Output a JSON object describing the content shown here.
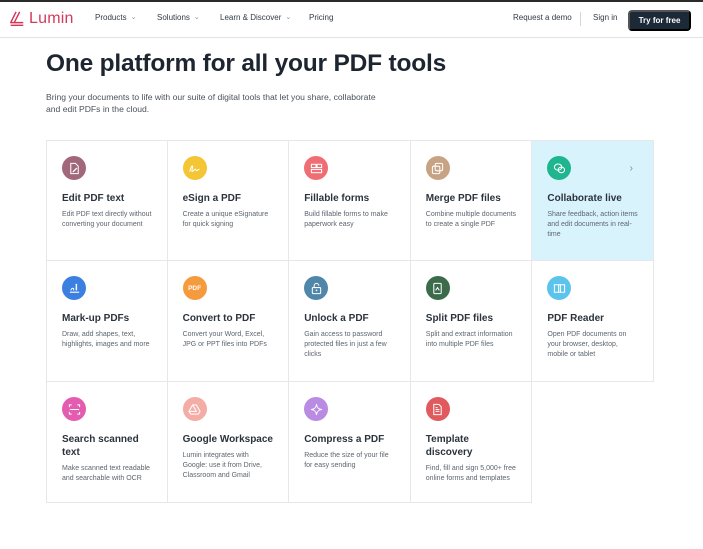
{
  "header": {
    "brand": "Lumin",
    "nav": [
      {
        "label": "Products",
        "has_dropdown": true
      },
      {
        "label": "Solutions",
        "has_dropdown": true
      },
      {
        "label": "Learn & Discover",
        "has_dropdown": true
      },
      {
        "label": "Pricing",
        "has_dropdown": false
      }
    ],
    "request_demo": "Request a demo",
    "sign_in": "Sign in",
    "try_free": "Try for free",
    "brand_color": "#d23b5c",
    "cta_color": "#1c2a38"
  },
  "hero": {
    "title": "One platform for all your PDF tools",
    "subtitle": "Bring your documents to life with our suite of digital tools that let you share, collaborate and edit PDFs in the cloud."
  },
  "tools": [
    {
      "title": "Edit PDF text",
      "desc": "Edit PDF text directly without converting your document",
      "icon": "edit-document-icon",
      "color": "#a0687a"
    },
    {
      "title": "eSign a PDF",
      "desc": "Create a unique eSignature for quick signing",
      "icon": "signature-icon",
      "color": "#f4c534"
    },
    {
      "title": "Fillable forms",
      "desc": "Build fillable forms to make paperwork easy",
      "icon": "form-icon",
      "color": "#ee6e74"
    },
    {
      "title": "Merge PDF files",
      "desc": "Combine multiple documents to create a single PDF",
      "icon": "merge-icon",
      "color": "#c7a383"
    },
    {
      "title": "Collaborate live",
      "desc": "Share feedback, action items and edit documents in real-time",
      "icon": "chat-bubbles-icon",
      "color": "#1fb58f",
      "active": true
    },
    {
      "title": "Mark-up PDFs",
      "desc": "Draw, add shapes, text, highlights, images and more",
      "icon": "markup-icon",
      "color": "#3b7fe0"
    },
    {
      "title": "Convert to PDF",
      "desc": "Convert your Word, Excel, JPG or PPT files into PDFs",
      "icon": "pdf-convert-icon",
      "color": "#f69a3e",
      "icon_text": "PDF"
    },
    {
      "title": "Unlock a PDF",
      "desc": "Gain access to password protected files in just a few clicks",
      "icon": "unlock-icon",
      "color": "#4f86aa"
    },
    {
      "title": "Split PDF files",
      "desc": "Split and extract information into multiple PDF files",
      "icon": "split-icon",
      "color": "#3b6b4a"
    },
    {
      "title": "PDF Reader",
      "desc": "Open PDF documents on your browser, desktop, mobile or tablet",
      "icon": "book-icon",
      "color": "#5bc3ec"
    },
    {
      "title": "Search scanned text",
      "desc": "Make scanned text readable and searchable with OCR",
      "icon": "scan-icon",
      "color": "#e35cb0"
    },
    {
      "title": "Google Workspace",
      "desc": "Lumin integrates with Google: use it from Drive, Classroom and Gmail",
      "icon": "google-drive-icon",
      "color": "#f3aca6"
    },
    {
      "title": "Compress a PDF",
      "desc": "Reduce the size of your file for easy sending",
      "icon": "sparkle-icon",
      "color": "#b98be2"
    },
    {
      "title": "Template discovery",
      "desc": "Find, fill and sign 5,000+ free online forms and templates",
      "icon": "template-icon",
      "color": "#e05a5e"
    }
  ]
}
